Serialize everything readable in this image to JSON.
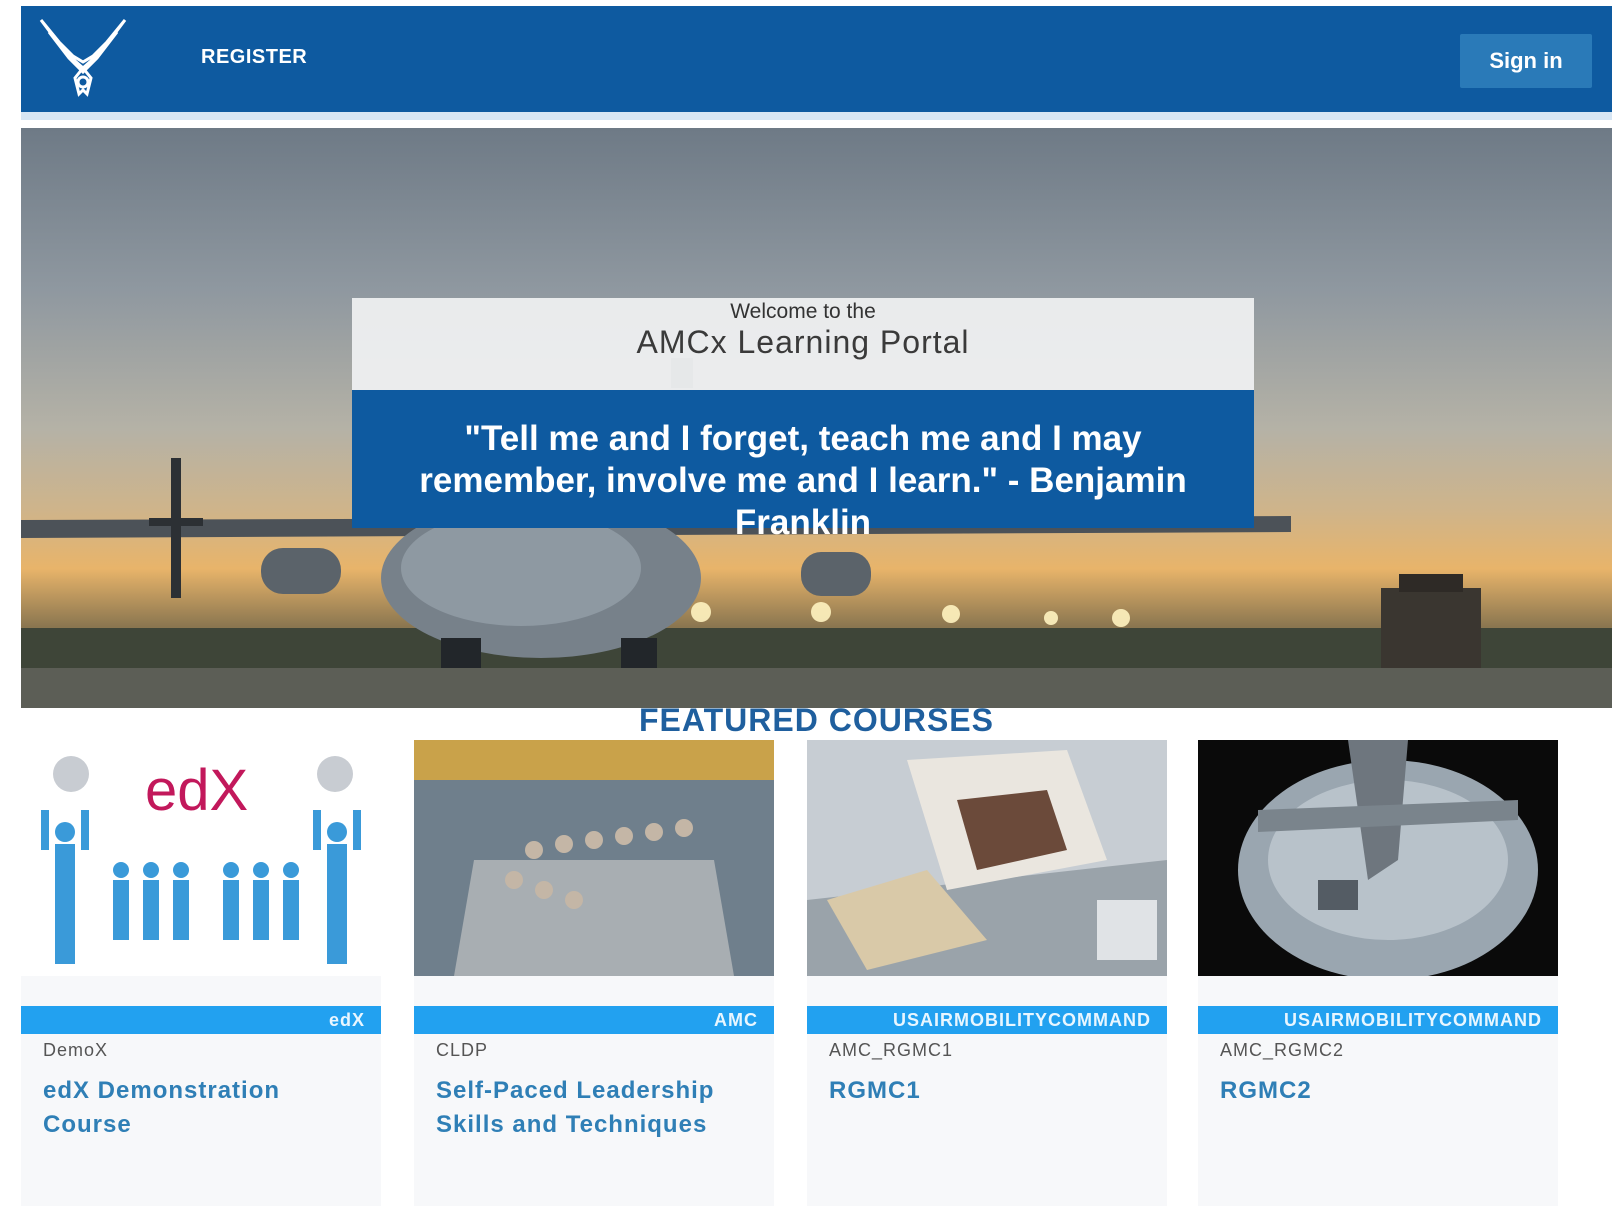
{
  "header": {
    "register_label": "REGISTER",
    "signin_label": "Sign in",
    "logo_icon": "air-force-wings-logo"
  },
  "hero": {
    "welcome_small": "Welcome to the",
    "welcome_title": "AMCx Learning Portal",
    "quote": "\"Tell me and I forget, teach me and I may remember, involve me and I learn.\" - Benjamin Franklin"
  },
  "featured": {
    "heading": "FEATURED COURSES",
    "courses": [
      {
        "org": "edX",
        "code": "DemoX",
        "title": "edX Demonstration Course"
      },
      {
        "org": "AMC",
        "code": "CLDP",
        "title": "Self-Paced Leadership Skills and Techniques"
      },
      {
        "org": "USAIRMOBILITYCOMMAND",
        "code": "AMC_RGMC1",
        "title": "RGMC1"
      },
      {
        "org": "USAIRMOBILITYCOMMAND",
        "code": "AMC_RGMC2",
        "title": "RGMC2"
      }
    ],
    "edx_logo_text": "edX"
  },
  "colors": {
    "header_blue": "#0e5aa0",
    "course_bar_blue": "#22a1f0",
    "heading_blue": "#1f5f9e"
  }
}
